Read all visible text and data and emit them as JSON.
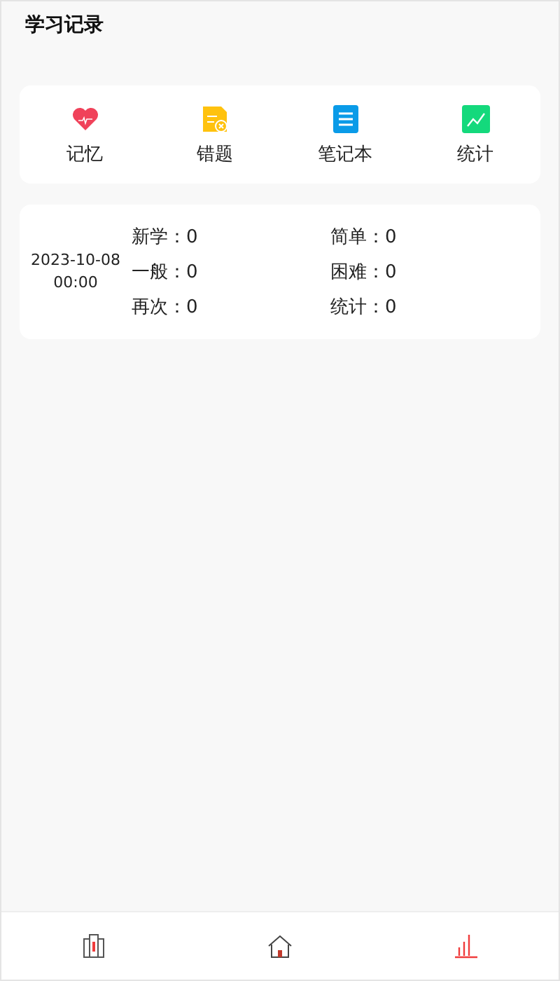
{
  "header": {
    "title": "学习记录"
  },
  "shortcuts": [
    {
      "kind": "memory",
      "label": "记忆"
    },
    {
      "kind": "mistakes",
      "label": "错题"
    },
    {
      "kind": "notebook",
      "label": "笔记本"
    },
    {
      "kind": "stats",
      "label": "统计"
    }
  ],
  "records": [
    {
      "date": "2023-10-08",
      "time": "00:00",
      "stats": [
        "新学：0",
        "简单：0",
        "一般：0",
        "困难：0",
        "再次：0",
        "统计：0"
      ]
    }
  ],
  "nav": [
    {
      "kind": "cards",
      "selected": false
    },
    {
      "kind": "home",
      "selected": false
    },
    {
      "kind": "chart",
      "selected": true
    }
  ]
}
